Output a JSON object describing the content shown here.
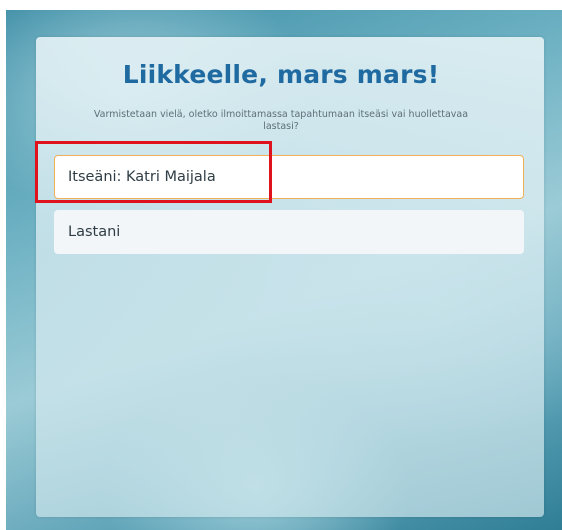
{
  "page": {
    "title": "Liikkeelle, mars mars!",
    "subtitle": "Varmistetaan vielä, oletko ilmoittamassa tapahtumaan itseäsi vai huollettavaa lastasi?"
  },
  "options": [
    {
      "label": "Itseäni: Katri Maijala",
      "selected": true
    },
    {
      "label": "Lastani",
      "selected": false
    }
  ],
  "colors": {
    "title": "#1f6aa0",
    "selected_border": "#f0b05a",
    "highlight": "#e0121c"
  }
}
